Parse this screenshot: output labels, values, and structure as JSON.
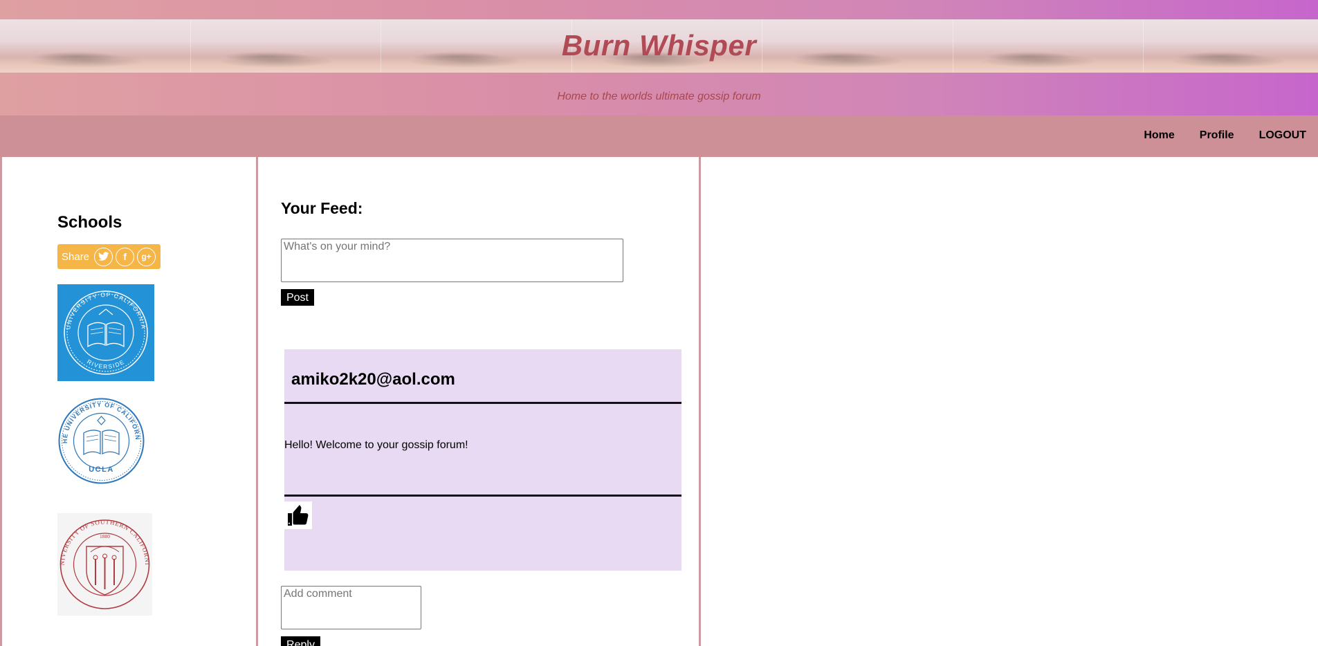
{
  "header": {
    "site_title": "Burn Whisper",
    "tagline": "Home to the worlds ultimate gossip forum"
  },
  "nav": {
    "items": [
      {
        "label": "Home"
      },
      {
        "label": "Profile"
      },
      {
        "label": "LOGOUT"
      }
    ]
  },
  "sidebar": {
    "title": "Schools",
    "share": {
      "label": "Share",
      "icons": [
        "twitter-icon",
        "facebook-icon",
        "google-plus-icon"
      ],
      "twitter": "🐦",
      "facebook": "f",
      "googleplus": "g+"
    },
    "schools": [
      {
        "name": "University of California Riverside",
        "seal_text": "UNIVERSITY OF CALIFORNIA · RIVERSIDE"
      },
      {
        "name": "UCLA",
        "seal_text": "THE UNIVERSITY OF CALIFORNIA · UCLA"
      },
      {
        "name": "University of Southern California",
        "seal_text": "UNIVERSITY OF SOUTHERN CALIFORNIA · 1880"
      }
    ]
  },
  "feed": {
    "title": "Your Feed:",
    "compose_placeholder": "What's on your mind?",
    "post_label": "Post",
    "posts": [
      {
        "author": "amiko2k20@aol.com",
        "body": "Hello! Welcome to your gossip forum!"
      }
    ],
    "comment_placeholder": "Add comment",
    "reply_label": "Reply"
  },
  "colors": {
    "title": "#b04a55",
    "navbar": "#cc9096",
    "post_bg": "#e8daf2",
    "share_bg": "#f6b547",
    "ucr_blue": "#2392d6",
    "ucla_blue": "#2f77b8",
    "usc_red": "#b03a3f"
  }
}
